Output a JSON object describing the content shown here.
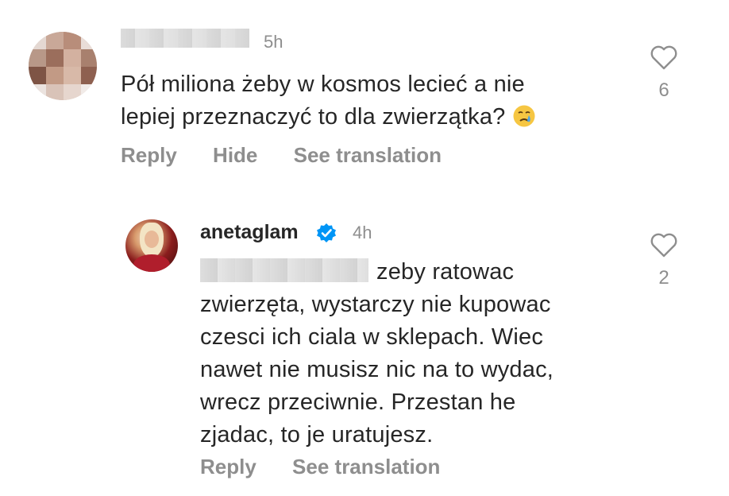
{
  "comments": [
    {
      "time": "5h",
      "text_line1": "Pół miliona żeby w kosmos lecieć a nie",
      "text_line2": "lepiej przeznaczyć to dla zwierzątka?",
      "emoji_icon": "crying-face-icon",
      "actions": {
        "reply": "Reply",
        "hide": "Hide",
        "see_translation": "See translation"
      },
      "likes": "6"
    },
    {
      "username": "anetaglam",
      "time": "4h",
      "text_line1": "zeby ratowac",
      "text_line2": "zwierzęta, wystarczy nie kupowac",
      "text_line3": "czesci ich ciala w sklepach. Wiec",
      "text_line4": "nawet nie musisz nic na to wydac,",
      "text_line5": "wrecz przeciwnie. Przestan he",
      "text_line6": "zjadac, to je uratujesz.",
      "actions": {
        "reply": "Reply",
        "see_translation": "See translation"
      },
      "likes": "2"
    }
  ],
  "colors": {
    "text": "#262626",
    "muted": "#8e8e8e",
    "verified": "#0095f6"
  }
}
